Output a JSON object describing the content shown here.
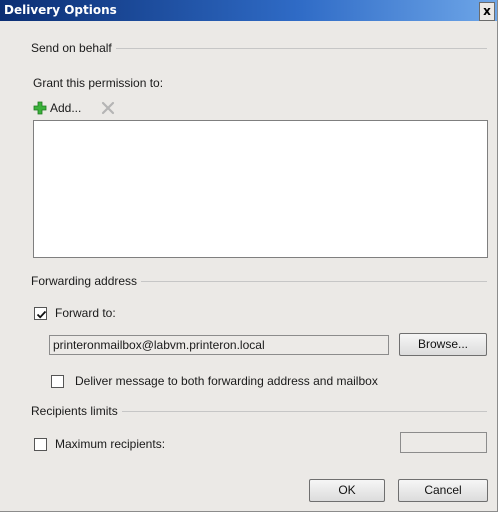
{
  "window": {
    "title": "Delivery Options",
    "close_label": "x"
  },
  "send_on_behalf": {
    "group_label": "Send on behalf",
    "grant_label": "Grant this permission to:",
    "add_label": "Add...",
    "icons": {
      "add": "green-plus-icon",
      "remove": "gray-x-icon"
    },
    "list_items": []
  },
  "forwarding": {
    "group_label": "Forwarding address",
    "forward_to_label": "Forward to:",
    "forward_to_checked": true,
    "address_value": "printeronmailbox@labvm.printeron.local",
    "browse_label": "Browse...",
    "deliver_both_label": "Deliver message to both forwarding address and mailbox",
    "deliver_both_checked": false
  },
  "recipients_limits": {
    "group_label": "Recipients limits",
    "max_recipients_label": "Maximum recipients:",
    "max_recipients_checked": false,
    "max_recipients_value": ""
  },
  "footer": {
    "ok_label": "OK",
    "cancel_label": "Cancel"
  },
  "colors": {
    "titlebar_start": "#0b2e73",
    "titlebar_end": "#6ea6e8",
    "dialog_bg": "#ebe9e6",
    "plus_green": "#3bb13b"
  }
}
